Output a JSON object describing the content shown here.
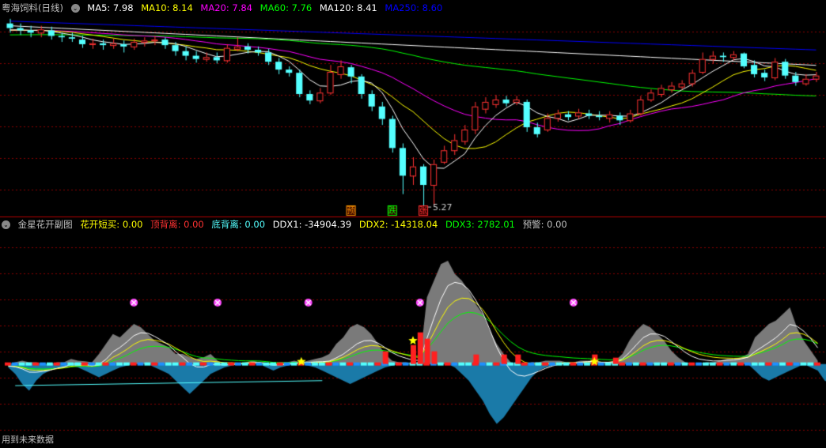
{
  "main_header": {
    "title": "粤海饲料(日线)",
    "ma5": "MA5: 7.98",
    "ma10": "MA10: 8.14",
    "ma20": "MA20: 7.84",
    "ma60": "MA60: 7.76",
    "ma120": "MA120: 8.41",
    "ma250": "MA250: 8.60"
  },
  "sub_header": {
    "title": "金星花开副图",
    "i1": "花开短买: 0.00",
    "i2": "顶背离: 0.00",
    "i3": "底背离: 0.00",
    "i4": "DDX1: -34904.39",
    "i5": "DDX2: -14318.04",
    "i6": "DDX3: 2782.01",
    "i7": "预警: 0.00"
  },
  "footer": "用到未来数据",
  "colors": {
    "up": "#ff3232",
    "down": "#54ffff",
    "ma5": "#ffffff",
    "ma10": "#ffff00",
    "ma20": "#ff00ff",
    "ma60": "#00ff00",
    "ma120": "#ffffff",
    "ma250": "#0000ff",
    "grid": "#8b0000"
  },
  "chart_data": [
    {
      "type": "candlestick",
      "low_label": "5.27",
      "ylim": [
        5.1,
        9.45
      ],
      "markers": [
        {
          "index": 33,
          "text": "预",
          "color": "#ff9900"
        },
        {
          "index": 37,
          "text": "跌",
          "color": "#00ff00"
        },
        {
          "index": 40,
          "text": "张",
          "color": "#ff3232"
        }
      ],
      "candles": [
        [
          9.25,
          9.15,
          9.35,
          9.05
        ],
        [
          9.15,
          9.1,
          9.25,
          9.0
        ],
        [
          9.1,
          9.05,
          9.2,
          8.95
        ],
        [
          9.05,
          9.12,
          9.2,
          8.95
        ],
        [
          9.1,
          8.98,
          9.18,
          8.9
        ],
        [
          8.98,
          8.95,
          9.05,
          8.85
        ],
        [
          8.95,
          8.92,
          9.05,
          8.85
        ],
        [
          8.9,
          8.8,
          8.98,
          8.72
        ],
        [
          8.8,
          8.82,
          8.92,
          8.7
        ],
        [
          8.82,
          8.78,
          8.9,
          8.68
        ],
        [
          8.78,
          8.82,
          8.92,
          8.7
        ],
        [
          8.8,
          8.75,
          8.88,
          8.62
        ],
        [
          8.75,
          8.85,
          8.92,
          8.68
        ],
        [
          8.85,
          8.88,
          8.95,
          8.75
        ],
        [
          8.88,
          8.9,
          8.98,
          8.78
        ],
        [
          8.9,
          8.78,
          8.95,
          8.7
        ],
        [
          8.78,
          8.65,
          8.85,
          8.55
        ],
        [
          8.65,
          8.55,
          8.75,
          8.45
        ],
        [
          8.55,
          8.48,
          8.65,
          8.4
        ],
        [
          8.48,
          8.52,
          8.62,
          8.42
        ],
        [
          8.52,
          8.45,
          8.62,
          8.38
        ],
        [
          8.45,
          8.72,
          8.8,
          8.4
        ],
        [
          8.7,
          8.75,
          8.95,
          8.65
        ],
        [
          8.75,
          8.68,
          8.82,
          8.6
        ],
        [
          8.68,
          8.62,
          8.75,
          8.55
        ],
        [
          8.62,
          8.42,
          8.7,
          8.35
        ],
        [
          8.42,
          8.25,
          8.5,
          8.15
        ],
        [
          8.25,
          8.18,
          8.32,
          8.1
        ],
        [
          8.18,
          7.72,
          8.25,
          7.65
        ],
        [
          7.72,
          7.58,
          7.8,
          7.5
        ],
        [
          7.58,
          7.75,
          7.85,
          7.52
        ],
        [
          7.75,
          8.2,
          8.35,
          7.7
        ],
        [
          8.15,
          8.32,
          8.45,
          8.05
        ],
        [
          8.3,
          8.1,
          8.35,
          7.95
        ],
        [
          8.1,
          7.72,
          8.15,
          7.62
        ],
        [
          7.72,
          7.45,
          7.8,
          7.35
        ],
        [
          7.45,
          7.18,
          7.55,
          7.05
        ],
        [
          7.18,
          6.55,
          7.25,
          6.45
        ],
        [
          6.55,
          5.95,
          6.65,
          5.55
        ],
        [
          5.95,
          6.15,
          6.35,
          5.75
        ],
        [
          6.15,
          5.75,
          6.2,
          5.27
        ],
        [
          5.75,
          6.2,
          6.3,
          5.3
        ],
        [
          6.25,
          6.5,
          6.6,
          6.2
        ],
        [
          6.5,
          6.72,
          6.85,
          6.4
        ],
        [
          6.7,
          6.95,
          7.05,
          6.62
        ],
        [
          6.95,
          7.45,
          7.55,
          6.85
        ],
        [
          7.4,
          7.55,
          7.65,
          7.3
        ],
        [
          7.5,
          7.6,
          7.7,
          7.42
        ],
        [
          7.6,
          7.52,
          7.68,
          7.45
        ],
        [
          7.55,
          7.6,
          7.68,
          7.48
        ],
        [
          7.55,
          7.0,
          7.6,
          6.9
        ],
        [
          7.0,
          6.85,
          7.1,
          6.78
        ],
        [
          6.95,
          7.2,
          7.3,
          6.9
        ],
        [
          7.2,
          7.3,
          7.38,
          7.12
        ],
        [
          7.28,
          7.22,
          7.35,
          7.15
        ],
        [
          7.25,
          7.32,
          7.4,
          7.18
        ],
        [
          7.3,
          7.25,
          7.38,
          7.18
        ],
        [
          7.25,
          7.22,
          7.35,
          7.15
        ],
        [
          7.2,
          7.28,
          7.35,
          7.1
        ],
        [
          7.25,
          7.15,
          7.32,
          7.05
        ],
        [
          7.15,
          7.3,
          7.38,
          7.1
        ],
        [
          7.3,
          7.6,
          7.68,
          7.25
        ],
        [
          7.6,
          7.75,
          7.82,
          7.55
        ],
        [
          7.72,
          7.85,
          7.92,
          7.65
        ],
        [
          7.82,
          7.9,
          7.98,
          7.75
        ],
        [
          7.88,
          7.95,
          8.02,
          7.82
        ],
        [
          7.95,
          8.18,
          8.25,
          7.88
        ],
        [
          8.2,
          8.48,
          8.62,
          8.15
        ],
        [
          8.48,
          8.55,
          8.65,
          8.38
        ],
        [
          8.55,
          8.52,
          8.62,
          8.42
        ],
        [
          8.52,
          8.58,
          8.65,
          8.45
        ],
        [
          8.6,
          8.32,
          8.62,
          8.28
        ],
        [
          8.35,
          8.15,
          8.45,
          8.08
        ],
        [
          8.18,
          8.08,
          8.25,
          8.0
        ],
        [
          8.08,
          8.42,
          8.5,
          8.02
        ],
        [
          8.42,
          8.12,
          8.48,
          8.05
        ],
        [
          8.12,
          7.98,
          8.2,
          7.9
        ],
        [
          7.95,
          8.05,
          8.15,
          7.9
        ],
        [
          8.05,
          8.12,
          8.2,
          7.98
        ]
      ]
    },
    {
      "type": "oscillator",
      "ylim": [
        -20,
        40
      ],
      "series_area": [
        0,
        0.5,
        1,
        0.5,
        0.5,
        0,
        0,
        0.5,
        0.5,
        1.5,
        1,
        0.8,
        0.5,
        3,
        6,
        9,
        8,
        10,
        12,
        11,
        9,
        7,
        6,
        5,
        3,
        3,
        2,
        1.5,
        2,
        3,
        1,
        0,
        0.5,
        0,
        0.5,
        1,
        0.5,
        0,
        0,
        0.5,
        0.5,
        1,
        0.5,
        1,
        1.5,
        2,
        3,
        6,
        8,
        11,
        12,
        11,
        9,
        6,
        3,
        1,
        0.5,
        0.5,
        0,
        1,
        20,
        25,
        30,
        31,
        27,
        25,
        22,
        18,
        15,
        10,
        6,
        3,
        0.5,
        0,
        0,
        0.5,
        0.5,
        1,
        1,
        1,
        0.5,
        0.5,
        1,
        1,
        1,
        0,
        0.5,
        1,
        3,
        7,
        10,
        12,
        11,
        9,
        7,
        4,
        2,
        0.5,
        0,
        0,
        0.5,
        0.5,
        1,
        1.5,
        1.5,
        2,
        3,
        8,
        10,
        12,
        13,
        15,
        17,
        11,
        7,
        4,
        1
      ],
      "series_neg": [
        -1,
        -3,
        -6,
        -8,
        -5,
        -3,
        -2,
        -1,
        -1,
        -0.5,
        -1,
        -2,
        -3,
        -4,
        -3,
        -2,
        -1,
        -0.5,
        0,
        0,
        0,
        -1,
        -2,
        -3,
        -5,
        -7,
        -9,
        -7,
        -5,
        -3,
        -2,
        -1,
        -0.5,
        0,
        0,
        0,
        0,
        -1,
        -2,
        -1,
        -0.5,
        0,
        0,
        -0.5,
        -1,
        -2,
        -3,
        -4,
        -5,
        -6,
        -5,
        -4,
        -3,
        -2,
        -1,
        -0.5,
        0,
        0,
        0,
        0,
        0,
        0,
        0,
        0,
        -1,
        -3,
        -5,
        -8,
        -11,
        -15,
        -18,
        -16,
        -13,
        -10,
        -7,
        -4,
        -2,
        -1,
        -0.5,
        0,
        0,
        0,
        0,
        0,
        0,
        0,
        0,
        0,
        0,
        0,
        0,
        0,
        0,
        0,
        0,
        0,
        0,
        0,
        0,
        0,
        0,
        0,
        0,
        0,
        0,
        0,
        0,
        -2,
        -4,
        -5,
        -4,
        -3,
        -2,
        -1,
        0,
        -1,
        -2,
        -5,
        -6,
        -4,
        -2,
        -1,
        0
      ],
      "stars": [
        42,
        58,
        84
      ],
      "markers": [
        18,
        30,
        43,
        59,
        81
      ]
    }
  ]
}
